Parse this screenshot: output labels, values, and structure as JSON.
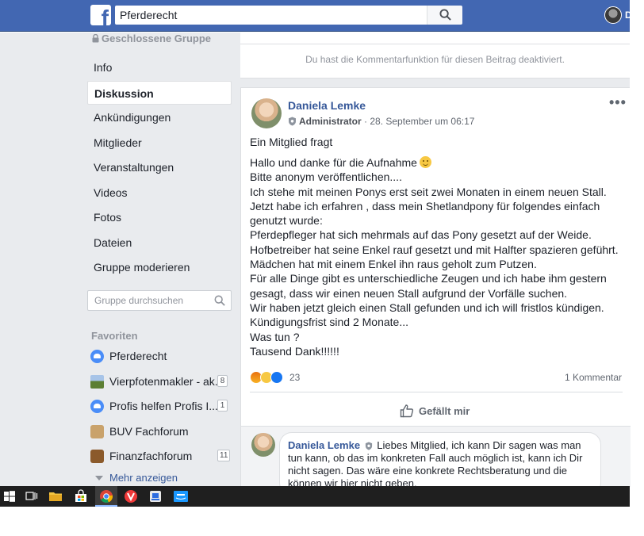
{
  "header": {
    "search_value": "Pferderecht",
    "user_initial": "D"
  },
  "sidebar": {
    "closed_group_label": "Geschlossene Gruppe",
    "nav": [
      {
        "label": "Info"
      },
      {
        "label": "Diskussion",
        "active": true
      },
      {
        "label": "Ankündigungen"
      },
      {
        "label": "Mitglieder"
      },
      {
        "label": "Veranstaltungen"
      },
      {
        "label": "Videos"
      },
      {
        "label": "Fotos"
      },
      {
        "label": "Dateien"
      },
      {
        "label": "Gruppe moderieren"
      }
    ],
    "group_search_placeholder": "Gruppe durchsuchen",
    "favorites_title": "Favoriten",
    "favorites": [
      {
        "label": "Pferderecht",
        "icon": "group-icon",
        "count": ""
      },
      {
        "label": "Vierpfotenmakler - ak...",
        "icon": "landscape-icon",
        "count": "8"
      },
      {
        "label": "Profis helfen Profis I...",
        "icon": "group-icon",
        "count": "1"
      },
      {
        "label": "BUV Fachforum",
        "icon": "teddy-bear-icon",
        "count": ""
      },
      {
        "label": "Finanzfachforum",
        "icon": "briefcase-icon",
        "count": "11"
      }
    ],
    "more_label": "Mehr anzeigen"
  },
  "notice": {
    "comments_disabled": "Du hast die Kommentarfunktion für diesen Beitrag deaktiviert."
  },
  "post": {
    "author": "Daniela Lemke",
    "role": "Administrator",
    "timestamp": "· 28. September um 06:17",
    "title": "Ein Mitglied fragt",
    "lines": [
      "Hallo und danke für die Aufnahme",
      "Bitte anonym veröffentlichen....",
      "Ich stehe mit meinen Ponys erst seit zwei Monaten in einem neuen Stall.",
      "Jetzt habe ich erfahren , dass mein Shetlandpony für folgendes einfach",
      "genutzt wurde:",
      "Pferdepfleger hat sich mehrmals auf das Pony gesetzt auf der Weide.",
      "Hofbetreiber hat seine Enkel rauf gesetzt und mit Halfter spazieren geführt.",
      "Mädchen hat mit einem Enkel ihn raus geholt zum Putzen.",
      "Für alle Dinge gibt es unterschiedliche Zeugen und ich habe ihm gestern",
      "gesagt, dass wir einen neuen Stall aufgrund der Vorfälle suchen.",
      "Wir haben jetzt gleich einen Stall gefunden und ich will fristlos kündigen.",
      "Kündigungsfrist sind 2 Monate...",
      "Was tun ?",
      "Tausend Dank!!!!!!"
    ],
    "reaction_count": "23",
    "comment_count": "1 Kommentar",
    "like_label": "Gefällt mir"
  },
  "comment": {
    "author": "Daniela Lemke",
    "text": "Liebes Mitglied, ich kann Dir sagen was man tun kann, ob das im konkreten Fall auch möglich ist, kann ich Dir nicht sagen. Das wäre eine konkrete Rechtsberatung und die können wir hier nicht geben."
  },
  "colors": {
    "facebook_blue": "#4267b2",
    "link_blue": "#365899",
    "page_bg": "#e9ebee"
  }
}
